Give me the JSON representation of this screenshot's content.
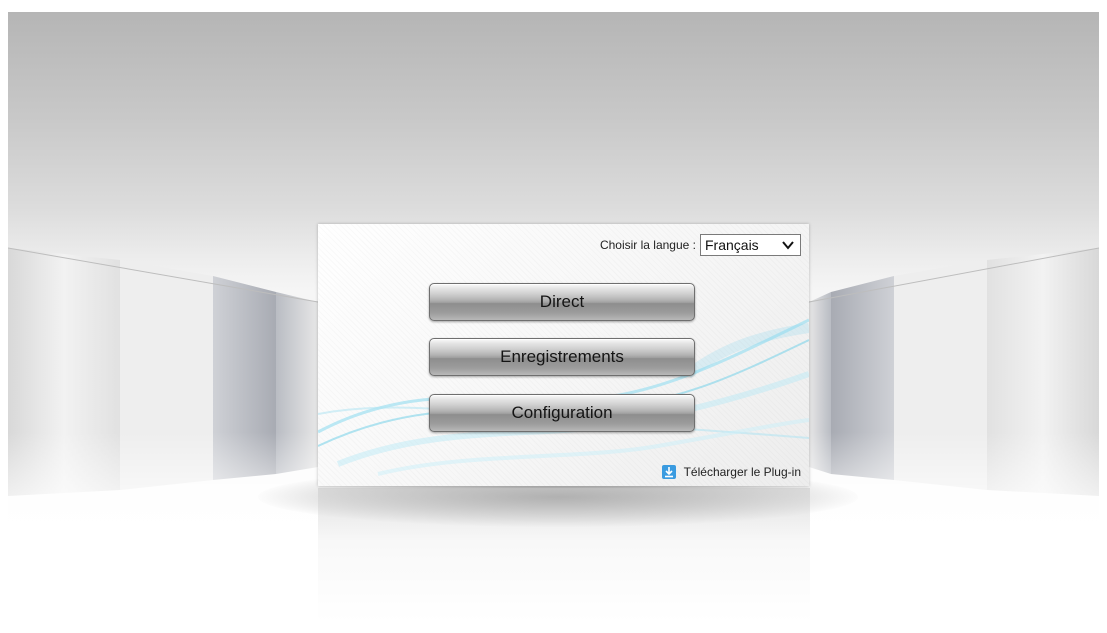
{
  "login_panel": {
    "language_label": "Choisir la langue :",
    "language_selected": "Français",
    "buttons": {
      "direct": "Direct",
      "recordings": "Enregistrements",
      "configuration": "Configuration"
    },
    "plugin_link": "Télécharger le Plug-in"
  },
  "icons": {
    "language_dropdown": "chevron-down-icon",
    "plugin": "download-icon"
  },
  "colors": {
    "accent_wave": "#7fd3ea",
    "plugin_icon": "#3a9be0",
    "button_face": "#9c9c9c"
  }
}
